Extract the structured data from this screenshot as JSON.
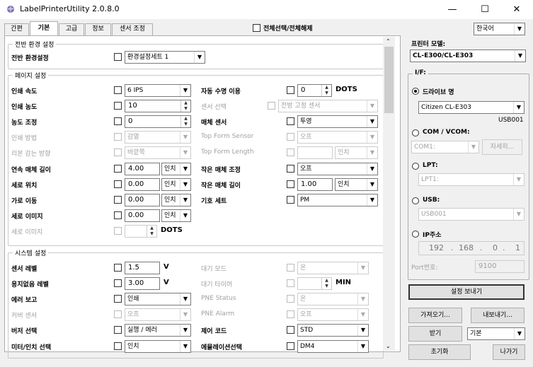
{
  "window": {
    "title": "LabelPrinterUtility 2.0.8.0",
    "minimize": "—",
    "maximize": "☐",
    "close": "✕"
  },
  "tabs": [
    "간편",
    "기본",
    "고급",
    "정보",
    "센서 조정"
  ],
  "select_all": "전체선택/전체해제",
  "language": "한국어",
  "groups": {
    "general": "전반 환경 설정",
    "page": "페이지 설정",
    "system": "시스템 설정"
  },
  "general": {
    "label": "전반 환경설정",
    "value": "환경설정세트 1"
  },
  "page_left": [
    {
      "label": "인쇄 속도",
      "value": "6 IPS"
    },
    {
      "label": "인쇄 농도",
      "value": "10"
    },
    {
      "label": "농도 조정",
      "value": "0"
    },
    {
      "label": "인쇄 방법",
      "value": "감열"
    },
    {
      "label": "리본 감는 방향",
      "value": "바깥쪽"
    },
    {
      "label": "연속 매체 길이",
      "value": "4.00",
      "unit": "인치"
    },
    {
      "label": "세로 위치",
      "value": "0.00",
      "unit": "인치"
    },
    {
      "label": "가로 이동",
      "value": "0.00",
      "unit": "인치"
    },
    {
      "label": "세로 이미지",
      "value": "0.00",
      "unit": "인치"
    },
    {
      "label": "세로 이미지",
      "value": "",
      "unit": "DOTS"
    }
  ],
  "page_right": [
    {
      "label": "자동 수명 이용",
      "value": "0",
      "unit": "DOTS"
    },
    {
      "label": "센서 선택",
      "value": "전방 고정 센서"
    },
    {
      "label": "매체 센서",
      "value": "투영"
    },
    {
      "label": "Top Form Sensor",
      "value": "오프"
    },
    {
      "label": "Top Form Length",
      "value": "",
      "unit": "인치"
    },
    {
      "label": "작은 매체 조정",
      "value": "오프"
    },
    {
      "label": "작은 매체 길이",
      "value": "1.00",
      "unit": "인치"
    },
    {
      "label": "기호 세트",
      "value": "PM"
    }
  ],
  "system_left": [
    {
      "label": "센서 레벨",
      "value": "1.5",
      "unit": "V"
    },
    {
      "label": "용지없음 레벨",
      "value": "3.00",
      "unit": "V"
    },
    {
      "label": "에러 보고",
      "value": "인쇄"
    },
    {
      "label": "커버 센서",
      "value": "오프"
    },
    {
      "label": "버저 선택",
      "value": "실행 / 에러"
    },
    {
      "label": "미터/인치 선택",
      "value": "인치"
    }
  ],
  "system_right": [
    {
      "label": "대기 모드",
      "value": "온"
    },
    {
      "label": "대기 타이머",
      "value": "",
      "unit": "MIN"
    },
    {
      "label": "PNE Status",
      "value": "온"
    },
    {
      "label": "PNE Alarm",
      "value": "오프"
    },
    {
      "label": "제어 코드",
      "value": "STD"
    },
    {
      "label": "에뮬레이션선택",
      "value": "DM4"
    }
  ],
  "right_panel": {
    "model_label": "프린터 모델:",
    "model_value": "CL-E300/CL-E303",
    "if_label": "I/F:",
    "driver_label": "드라이브 명",
    "driver_value": "Citizen CL-E303",
    "driver_port": "USB001",
    "com_label": "COM / VCOM:",
    "com_value": "COM1:",
    "com_detail": "자세히...",
    "lpt_label": "LPT:",
    "lpt_value": "LPT1:",
    "usb_label": "USB:",
    "usb_value": "USB001",
    "ip_label": "IP주소",
    "ip": [
      "192",
      "168",
      "0",
      "1"
    ],
    "port_label": "Port번호:",
    "port_value": "9100",
    "send": "설정 보내기",
    "import": "가져오기...",
    "export": "내보내기...",
    "receive": "받기",
    "receive_mode": "기본",
    "reset": "초기화",
    "exit": "나가기"
  }
}
